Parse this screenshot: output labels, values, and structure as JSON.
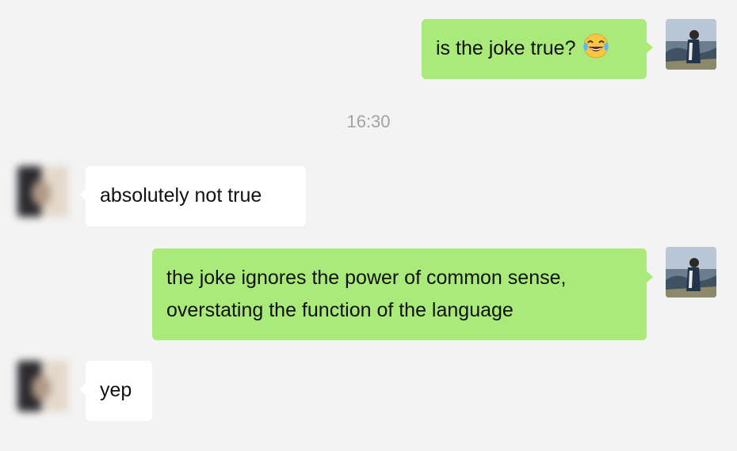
{
  "messages": [
    {
      "sender": "me",
      "text": "is the joke true?",
      "emoji": "tears-of-joy-emoji"
    },
    {
      "sender": "timestamp",
      "text": "16:30"
    },
    {
      "sender": "them",
      "text": "absolutely not true"
    },
    {
      "sender": "me",
      "line1": "the joke ignores the power of common sense,",
      "line2": "overstating the function of the language"
    },
    {
      "sender": "them",
      "text": "yep"
    }
  ],
  "colors": {
    "background": "#f3f3f3",
    "my_bubble": "#a9ea7a",
    "their_bubble": "#ffffff",
    "timestamp": "#a3a3a3",
    "text": "#111111"
  }
}
